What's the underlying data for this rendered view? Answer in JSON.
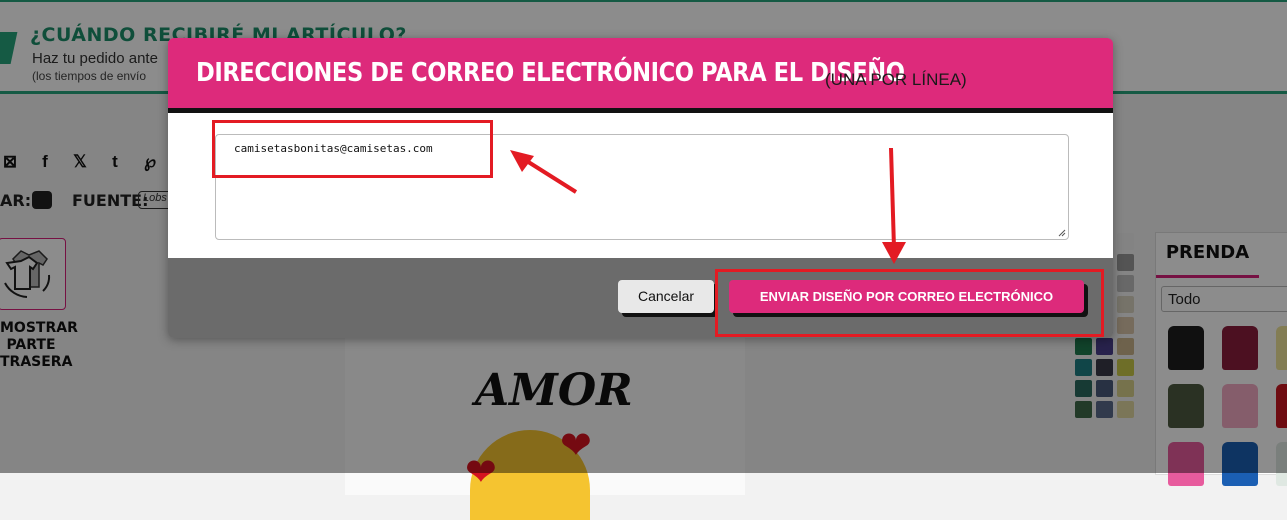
{
  "banner": {
    "title": "¿CUÁNDO RECIBIRÉ MI ARTÍCULO?",
    "subtitle": "Haz tu pedido ante",
    "note": "(los tiempos de envío"
  },
  "toolbar": {
    "color_label": "AR:",
    "font_label": "FUENTE:",
    "font_value": "Lobs"
  },
  "back_button": {
    "label": "MOSTRAR PARTE TRASERA"
  },
  "design": {
    "text": "AMOR"
  },
  "product_panel": {
    "tab_label": "PRENDA",
    "filter_value": "Todo"
  },
  "modal": {
    "title": "DIRECCIONES DE CORREO ELECTRÓNICO PARA EL DISEÑO",
    "title_note": "(UNA POR LÍNEA)",
    "email_value": "camisetasbonitas@camisetas.com",
    "cancel_label": "Cancelar",
    "send_label": "ENVIAR DISEÑO POR CORREO ELECTRÓNICO"
  },
  "colors": {
    "brand_pink": "#dd2a7b",
    "brand_green": "#27a57c",
    "annotation_red": "#e31b23"
  }
}
